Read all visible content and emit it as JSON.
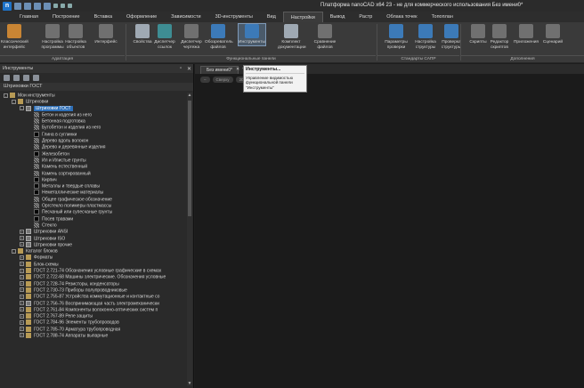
{
  "titlebar": {
    "logo_letter": "n",
    "title": "Платформа nanoCAD x64 23 - не для коммерческого использования Без имени0*"
  },
  "menu_tabs": [
    "Главная",
    "Построение",
    "Вставка",
    "Оформление",
    "Зависимости",
    "3D-инструменты",
    "Вид",
    "Настройки",
    "Вывод",
    "Растр",
    "Облака точек",
    "Топоплан"
  ],
  "active_menu_tab": "Настройки",
  "ribbon": {
    "buttons": [
      {
        "label": "Классический интерфейс",
        "icon": "classic-ui-icon"
      },
      {
        "label": "Настройка программы",
        "icon": "program-settings-icon"
      },
      {
        "label": "Настройка объектов",
        "icon": "object-settings-icon"
      },
      {
        "label": "Интерфейс",
        "icon": "interface-icon"
      },
      {
        "label": "Свойства",
        "icon": "properties-icon"
      },
      {
        "label": "Диспетчер ссылок",
        "icon": "link-manager-icon"
      },
      {
        "label": "Диспетчер чертежа",
        "icon": "drawing-manager-icon"
      },
      {
        "label": "Обозреватель файлов",
        "icon": "file-browser-icon"
      },
      {
        "label": "Инструменты",
        "icon": "tools-icon"
      },
      {
        "label": "Комплект документации",
        "icon": "documentation-set-icon"
      },
      {
        "label": "Сравнение файлов",
        "icon": "file-compare-icon"
      },
      {
        "label": "Параметры проверки",
        "icon": "check-params-icon"
      },
      {
        "label": "Настройка структуры",
        "icon": "structure-settings-icon"
      },
      {
        "label": "Проверка структуры",
        "icon": "structure-check-icon"
      },
      {
        "label": "Скрипты",
        "icon": "scripts-icon"
      },
      {
        "label": "Редактор скриптов",
        "icon": "script-editor-icon"
      },
      {
        "label": "Приложения",
        "icon": "applications-icon"
      },
      {
        "label": "Сценарий",
        "icon": "scenario-icon"
      }
    ],
    "groups": [
      "Адаптация",
      "Функциональные панели",
      "Стандарты САПР",
      "Дополнения"
    ]
  },
  "panel": {
    "title": "Инструменты",
    "subtitle": "Штриховки ГОСТ",
    "tree": [
      {
        "level": 0,
        "label": "Мои инструменты",
        "icon": "folder",
        "exp": "-"
      },
      {
        "level": 1,
        "label": "Штриховки",
        "icon": "folder",
        "exp": "-"
      },
      {
        "level": 2,
        "label": "Штриховки ГОСТ",
        "icon": "grid",
        "exp": "-",
        "selected": true
      },
      {
        "level": 3,
        "label": "Бетон и изделия из него",
        "icon": "hatch"
      },
      {
        "level": 3,
        "label": "Бетонная подготовка",
        "icon": "hatch"
      },
      {
        "level": 3,
        "label": "Бутобетон и изделия из него",
        "icon": "hatch"
      },
      {
        "level": 3,
        "label": "Глина в суглинки",
        "icon": "black"
      },
      {
        "level": 3,
        "label": "Дерево вдоль волокон",
        "icon": "hatch"
      },
      {
        "level": 3,
        "label": "Дерево и деревянные изделия",
        "icon": "hatch"
      },
      {
        "level": 3,
        "label": "Железобетон",
        "icon": "black"
      },
      {
        "level": 3,
        "label": "Ил и Илистые грунты",
        "icon": "hatch"
      },
      {
        "level": 3,
        "label": "Камень естественный",
        "icon": "hatch"
      },
      {
        "level": 3,
        "label": "Камень сортированный",
        "icon": "hatch"
      },
      {
        "level": 3,
        "label": "Кирпич",
        "icon": "black"
      },
      {
        "level": 3,
        "label": "Металлы и твердые сплавы",
        "icon": "black"
      },
      {
        "level": 3,
        "label": "Неметаллические материалы",
        "icon": "black"
      },
      {
        "level": 3,
        "label": "Общее графическое обозначение",
        "icon": "hatch"
      },
      {
        "level": 3,
        "label": "Оргстекло полимеры пластмассы",
        "icon": "hatch"
      },
      {
        "level": 3,
        "label": "Песчаный или супесчаные грунты",
        "icon": "black"
      },
      {
        "level": 3,
        "label": "Посев травами",
        "icon": "black"
      },
      {
        "level": 3,
        "label": "Стекло",
        "icon": "hatch"
      },
      {
        "level": 2,
        "label": "Штриховки ANSI",
        "icon": "grid",
        "exp": "+"
      },
      {
        "level": 2,
        "label": "Штриховки ISO",
        "icon": "grid",
        "exp": "+"
      },
      {
        "level": 2,
        "label": "Штриховки прочие",
        "icon": "grid",
        "exp": "+"
      },
      {
        "level": 1,
        "label": "Каталог блоков",
        "icon": "folder",
        "exp": "-"
      },
      {
        "level": 2,
        "label": "Форматы",
        "icon": "folder",
        "exp": "+"
      },
      {
        "level": 2,
        "label": "Блок-схемы",
        "icon": "folder",
        "exp": "+"
      },
      {
        "level": 2,
        "label": "ГОСТ 2.721-74 Обозначения условные графические в схемах",
        "icon": "folder",
        "exp": "+"
      },
      {
        "level": 2,
        "label": "ГОСТ 2.722-68 Машины электрические. Обозначения условные",
        "icon": "folder",
        "exp": "+"
      },
      {
        "level": 2,
        "label": "ГОСТ 2.728-74 Резисторы, конденсаторы",
        "icon": "folder",
        "exp": "+"
      },
      {
        "level": 2,
        "label": "ГОСТ 2.730-73 Приборы полупроводниковые",
        "icon": "folder",
        "exp": "+"
      },
      {
        "level": 2,
        "label": "ГОСТ 2.755-87 Устройства коммутационные и контактные со",
        "icon": "folder",
        "exp": "+"
      },
      {
        "level": 2,
        "label": "ГОСТ 2.756-76 Воспринимающая часть электромеханически",
        "icon": "grid",
        "exp": "+"
      },
      {
        "level": 2,
        "label": "ГОСТ 2.761-84 Компоненты волоконно-оптических систем п",
        "icon": "folder",
        "exp": "+"
      },
      {
        "level": 2,
        "label": "ГОСТ 2.767-89 Реле защиты",
        "icon": "folder",
        "exp": "+"
      },
      {
        "level": 2,
        "label": "ГОСТ 2.784-96 Элементы трубопроводов",
        "icon": "folder",
        "exp": "+"
      },
      {
        "level": 2,
        "label": "ГОСТ 2.785-70 Арматура трубопроводная",
        "icon": "folder",
        "exp": "+"
      },
      {
        "level": 2,
        "label": "ГОСТ 2.788-74 Аппараты выпарные",
        "icon": "folder",
        "exp": "+"
      }
    ]
  },
  "drawing": {
    "doc_tab": "Без имени0*",
    "view_controls": [
      "–",
      "Сверху",
      "2D-каркас"
    ],
    "tooltip_title": "Инструменты...",
    "tooltip_desc": "Управление видимостью функциональной панели \"Инструменты\""
  },
  "colors": {
    "accent": "#2e6fb7",
    "background": "#1b1b1b",
    "ribbon": "#3a3a3a"
  }
}
